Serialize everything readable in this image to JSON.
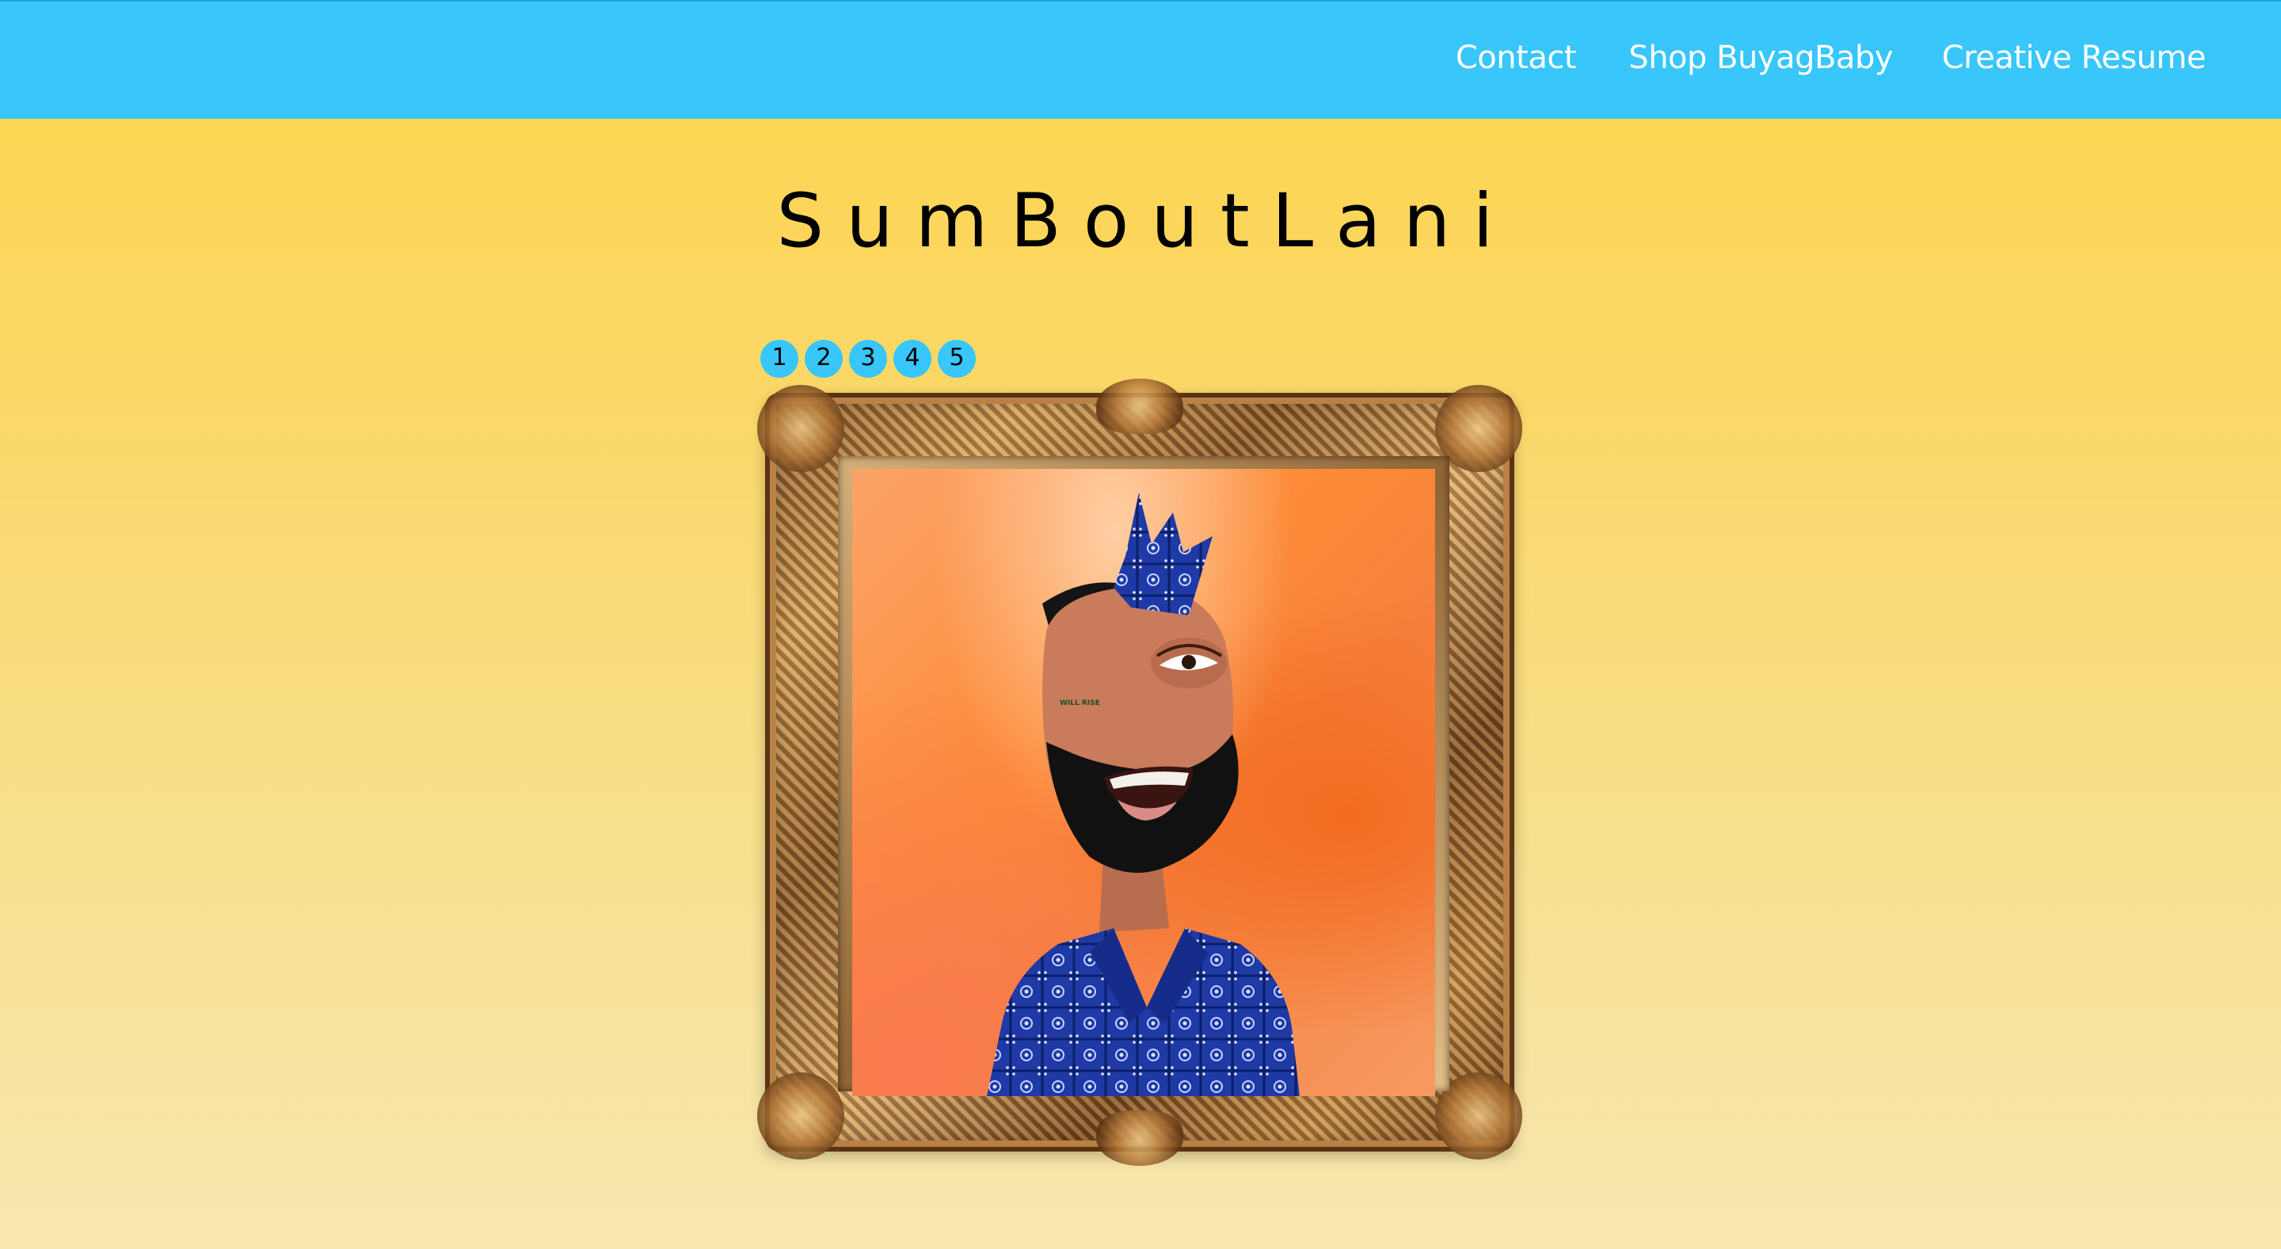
{
  "nav": {
    "links": [
      {
        "label": "Contact"
      },
      {
        "label": "Shop BuyagBaby"
      },
      {
        "label": "Creative Resume"
      }
    ]
  },
  "site": {
    "title": "SumBoutLani"
  },
  "slideshow": {
    "pages": [
      "1",
      "2",
      "3",
      "4",
      "5"
    ]
  },
  "artwork": {
    "tattoo_text": "WILL RISE"
  },
  "colors": {
    "navbar": "#38c6fb",
    "pager_dot": "#38c6fb",
    "background_top": "#fdd34a",
    "background_bottom": "#f7e7b0",
    "bandana_blue": "#1f3aa6"
  }
}
